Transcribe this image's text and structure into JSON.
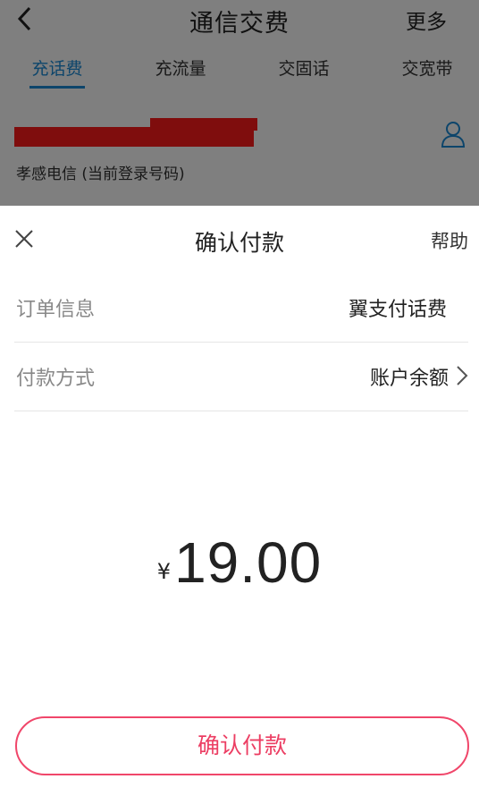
{
  "background": {
    "title": "通信交费",
    "more_label": "更多",
    "tabs": [
      {
        "label": "充话费",
        "active": true
      },
      {
        "label": "充流量",
        "active": false
      },
      {
        "label": "交固话",
        "active": false
      },
      {
        "label": "交宽带",
        "active": false
      }
    ],
    "carrier_text": "孝感电信 (当前登录号码)",
    "accent_color": "#1a8bd6"
  },
  "sheet": {
    "title": "确认付款",
    "help_label": "帮助",
    "rows": {
      "order": {
        "label": "订单信息",
        "value": "翼支付话费"
      },
      "method": {
        "label": "付款方式",
        "value": "账户余额"
      }
    },
    "amount": {
      "currency": "¥",
      "value": "19.00"
    },
    "confirm_label": "确认付款",
    "confirm_color": "#ec3e63",
    "icons": {
      "close": "close-icon",
      "chevron": "chevron-right-icon",
      "back": "back-arrow-icon",
      "contact": "contact-person-icon"
    }
  }
}
